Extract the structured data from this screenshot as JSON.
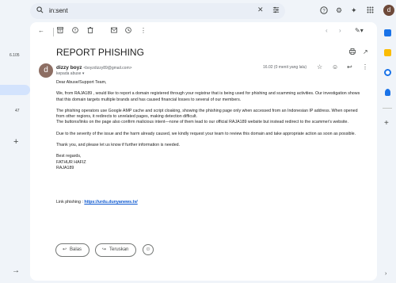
{
  "left_rail": {
    "count_top": "6.105",
    "count_mid": "47"
  },
  "search": {
    "query": "in:sent"
  },
  "topbar": {
    "avatar_letter": "d"
  },
  "email": {
    "subject": "REPORT PHISHING",
    "sender_name": "dizzy boyz",
    "sender_email": "<boyzdizzy89@gmail.com>",
    "to": "kepada abuse",
    "time": "16.02 (0 menit yang lalu)",
    "avatar_letter": "d",
    "greeting": "Dear Abuse/Support Team,",
    "p1": "We, from RAJA189 , would like to report a domain registered through your registrar that is being used for phishing and scamming activities. Our investigation shows that this domain targets multiple brands and has caused financial losses to several of our members.",
    "p2": "The phishing operators use Google AMP cache and script cloaking, showing the phishing page only when accessed from an Indonesian IP address. When opened from other regions, it redirects to unrelated pages, making detection difficult.",
    "p3": "The buttons/links on the page also confirm malicious intent—none of them lead to our official RAJA189 website but instead redirect to the scammer's website.",
    "p4": "Due to the severity of the issue and the harm already caused, we kindly request your team to review this domain and take appropriate action as soon as possible.",
    "p5": "Thank you, and please let us know if further information is needed.",
    "regards": "Best regards,",
    "sig_name": "FATHUR HAFIZ",
    "sig_org": "RAJA189",
    "link_label": "Link phishing : ",
    "link_url": "https://urdu.dunyanews.tv/"
  },
  "actions": {
    "reply": "Balas",
    "forward": "Teruskan"
  },
  "colors": {
    "accent": "#0b57d0",
    "background": "#f0f4f9",
    "selected": "#d3e3fd"
  },
  "icons": {
    "toolbar": [
      "back-arrow",
      "archive",
      "report-spam",
      "delete",
      "mark-unread",
      "snooze",
      "more"
    ],
    "right_rail": [
      "calendar",
      "keep",
      "tasks",
      "contacts"
    ]
  }
}
